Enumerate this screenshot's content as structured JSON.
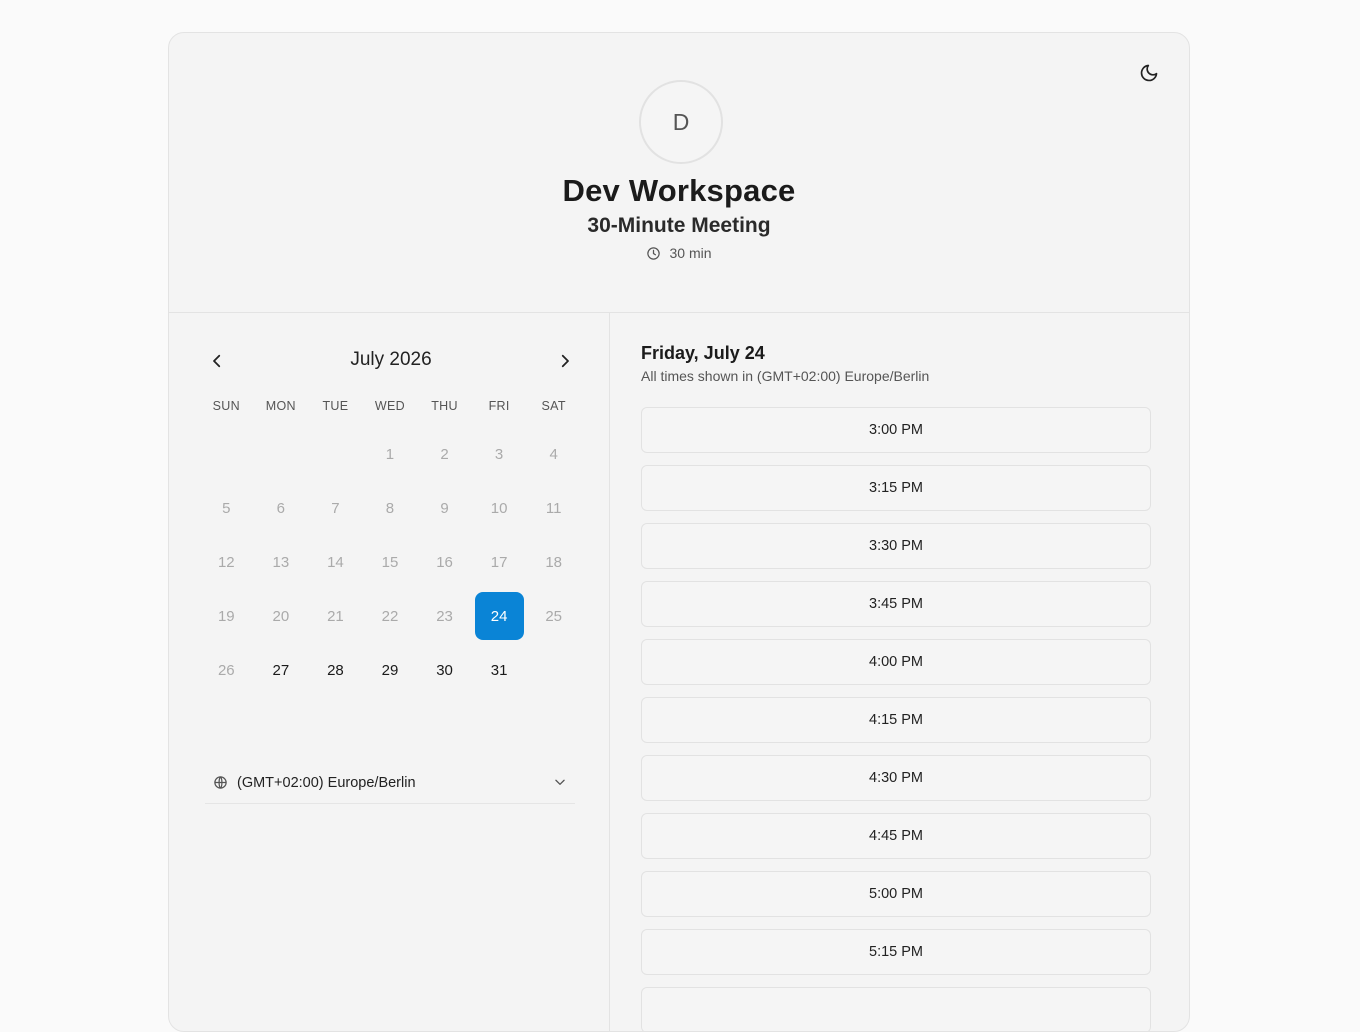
{
  "header": {
    "avatar_initial": "D",
    "workspace_name": "Dev Workspace",
    "meeting_title": "30-Minute Meeting",
    "duration": "30 min"
  },
  "calendar": {
    "month_label": "July 2026",
    "weekdays": [
      "SUN",
      "MON",
      "TUE",
      "WED",
      "THU",
      "FRI",
      "SAT"
    ],
    "leading_blanks": 3,
    "days": [
      {
        "n": "1",
        "state": "disabled"
      },
      {
        "n": "2",
        "state": "disabled"
      },
      {
        "n": "3",
        "state": "disabled"
      },
      {
        "n": "4",
        "state": "disabled"
      },
      {
        "n": "5",
        "state": "disabled"
      },
      {
        "n": "6",
        "state": "disabled"
      },
      {
        "n": "7",
        "state": "disabled"
      },
      {
        "n": "8",
        "state": "disabled"
      },
      {
        "n": "9",
        "state": "disabled"
      },
      {
        "n": "10",
        "state": "disabled"
      },
      {
        "n": "11",
        "state": "disabled"
      },
      {
        "n": "12",
        "state": "disabled"
      },
      {
        "n": "13",
        "state": "disabled"
      },
      {
        "n": "14",
        "state": "disabled"
      },
      {
        "n": "15",
        "state": "disabled"
      },
      {
        "n": "16",
        "state": "disabled"
      },
      {
        "n": "17",
        "state": "disabled"
      },
      {
        "n": "18",
        "state": "disabled"
      },
      {
        "n": "19",
        "state": "disabled"
      },
      {
        "n": "20",
        "state": "disabled"
      },
      {
        "n": "21",
        "state": "disabled"
      },
      {
        "n": "22",
        "state": "disabled"
      },
      {
        "n": "23",
        "state": "disabled"
      },
      {
        "n": "24",
        "state": "selected"
      },
      {
        "n": "25",
        "state": "disabled"
      },
      {
        "n": "26",
        "state": "disabled"
      },
      {
        "n": "27",
        "state": "available"
      },
      {
        "n": "28",
        "state": "available"
      },
      {
        "n": "29",
        "state": "available"
      },
      {
        "n": "30",
        "state": "available"
      },
      {
        "n": "31",
        "state": "available"
      }
    ],
    "timezone": "(GMT+02:00) Europe/Berlin"
  },
  "slots_panel": {
    "date_title": "Friday, July 24",
    "tz_note": "All times shown in (GMT+02:00) Europe/Berlin",
    "slots": [
      "3:00 PM",
      "3:15 PM",
      "3:30 PM",
      "3:45 PM",
      "4:00 PM",
      "4:15 PM",
      "4:30 PM",
      "4:45 PM",
      "5:00 PM",
      "5:15 PM",
      ""
    ]
  },
  "colors": {
    "accent": "#0a84d6",
    "background": "#fafafa",
    "card": "#f4f4f4"
  },
  "icons": {
    "theme_toggle": "moon-icon",
    "duration": "clock-icon",
    "prev": "chevron-left-icon",
    "next": "chevron-right-icon",
    "timezone": "globe-icon",
    "dropdown": "chevron-down-icon"
  }
}
